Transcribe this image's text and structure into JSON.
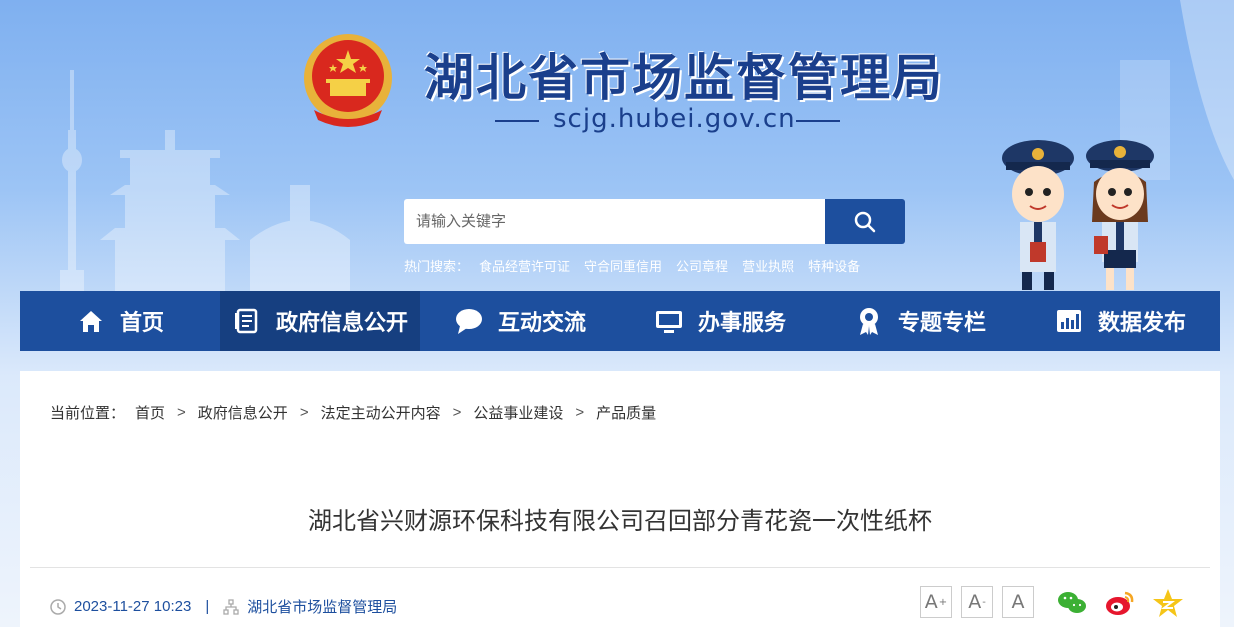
{
  "header": {
    "title": "湖北省市场监督管理局",
    "domain": "scjg.hubei.gov.cn"
  },
  "search": {
    "placeholder": "请输入关键字",
    "hot_label": "热门搜索：",
    "hot_items": [
      "食品经营许可证",
      "守合同重信用",
      "公司章程",
      "营业执照",
      "特种设备"
    ]
  },
  "nav": {
    "items": [
      {
        "label": "首页",
        "icon": "home-icon"
      },
      {
        "label": "政府信息公开",
        "icon": "document-icon"
      },
      {
        "label": "互动交流",
        "icon": "chat-icon"
      },
      {
        "label": "办事服务",
        "icon": "monitor-icon"
      },
      {
        "label": "专题专栏",
        "icon": "award-icon"
      },
      {
        "label": "数据发布",
        "icon": "bar-chart-icon"
      }
    ],
    "active_index": 1
  },
  "breadcrumb": {
    "label": "当前位置：",
    "items": [
      "首页",
      "政府信息公开",
      "法定主动公开内容",
      "公益事业建设",
      "产品质量"
    ],
    "separator": ">"
  },
  "article": {
    "title": "湖北省兴财源环保科技有限公司召回部分青花瓷一次性纸杯",
    "date": "2023-11-27 10:23",
    "separator": "|",
    "source": "湖北省市场监督管理局"
  },
  "font_controls": {
    "increase": "A",
    "decrease": "A",
    "reset": "A"
  },
  "share": [
    "wechat-icon",
    "weibo-icon",
    "qzone-icon"
  ],
  "colors": {
    "primary": "#1d4f9e",
    "nav_active": "#163f80",
    "title_blue": "#1a3f8c"
  }
}
